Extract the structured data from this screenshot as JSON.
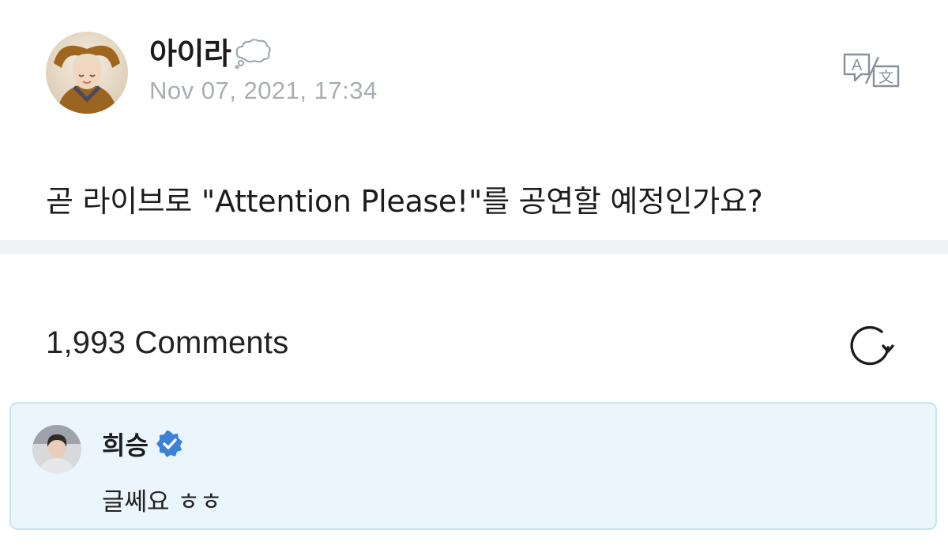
{
  "post": {
    "author_name": "아이라",
    "author_status_icon": "thought-bubble-icon",
    "timestamp": "Nov 07, 2021, 17:34",
    "translate_icon": "translate-icon",
    "body": "곧 라이브로 \"Attention Please!\"를 공연할 예정인가요?"
  },
  "comments": {
    "count_label": "1,993 Comments",
    "refresh_icon": "refresh-icon",
    "highlighted": {
      "author_name": "희승",
      "verified_icon": "verified-badge-icon",
      "text": "글쎄요 ㅎㅎ"
    }
  },
  "colors": {
    "timestamp": "#a9adb3",
    "divider": "#f1f2f5",
    "comment_highlight_bg": "#eaf6fc",
    "comment_highlight_border": "#c8e3f1",
    "verified": "#3b82d6"
  }
}
